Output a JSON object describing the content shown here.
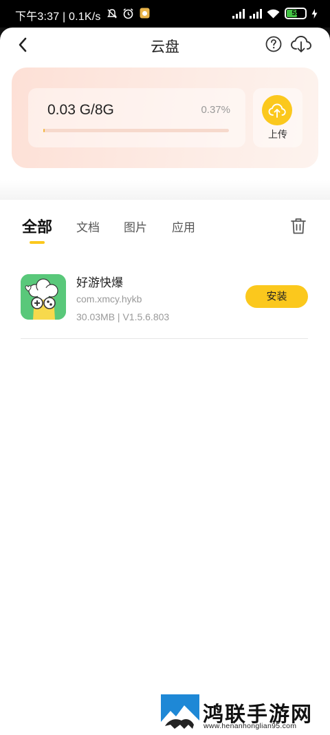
{
  "status_bar": {
    "time": "下午3:37 | 0.1K/s",
    "battery": "55",
    "icons": [
      "mute-icon",
      "alarm-icon",
      "app-notification-icon",
      "signal-icon",
      "signal-icon",
      "wifi-icon",
      "battery-icon",
      "charging-icon"
    ]
  },
  "header": {
    "title": "云盘",
    "icons": [
      "back-icon",
      "help-icon",
      "cloud-download-icon"
    ]
  },
  "storage": {
    "usage": "0.03 G/8G",
    "percent": "0.37%",
    "progress_fraction": 0.0037,
    "upload_label": "上传"
  },
  "tabs": [
    {
      "label": "全部",
      "active": true
    },
    {
      "label": "文档",
      "active": false
    },
    {
      "label": "图片",
      "active": false
    },
    {
      "label": "应用",
      "active": false
    }
  ],
  "files": [
    {
      "name": "好游快爆",
      "package": "com.xmcy.hykb",
      "meta": "30.03MB | V1.5.6.803",
      "action": "安装"
    }
  ],
  "watermark": {
    "name": "鸿联手游网",
    "url": "www.henanhonglian95.com"
  },
  "colors": {
    "accent": "#fbc81d",
    "card_bg": "#fde0d6",
    "app_icon_bg": "#59c87a"
  }
}
